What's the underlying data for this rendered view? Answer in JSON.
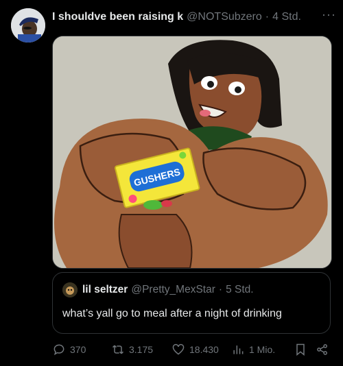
{
  "post": {
    "display_name": "I shouldve been raising k",
    "handle": "@NOTSubzero",
    "time": "4 Std.",
    "more_label": "···"
  },
  "quote": {
    "display_name": "lil seltzer",
    "handle": "@Pretty_MexStar",
    "time": "5 Std.",
    "text": "what’s yall go to meal after a night of drinking"
  },
  "media": {
    "package_label": "GUSHERS"
  },
  "actions": {
    "replies": "370",
    "reposts": "3.175",
    "likes": "18.430",
    "views": "1 Mio."
  },
  "icons": {
    "reply": "speech-bubble-icon",
    "repost": "repost-arrows-icon",
    "like": "heart-icon",
    "views": "bar-chart-icon",
    "bookmark": "bookmark-icon",
    "share": "share-icon"
  }
}
